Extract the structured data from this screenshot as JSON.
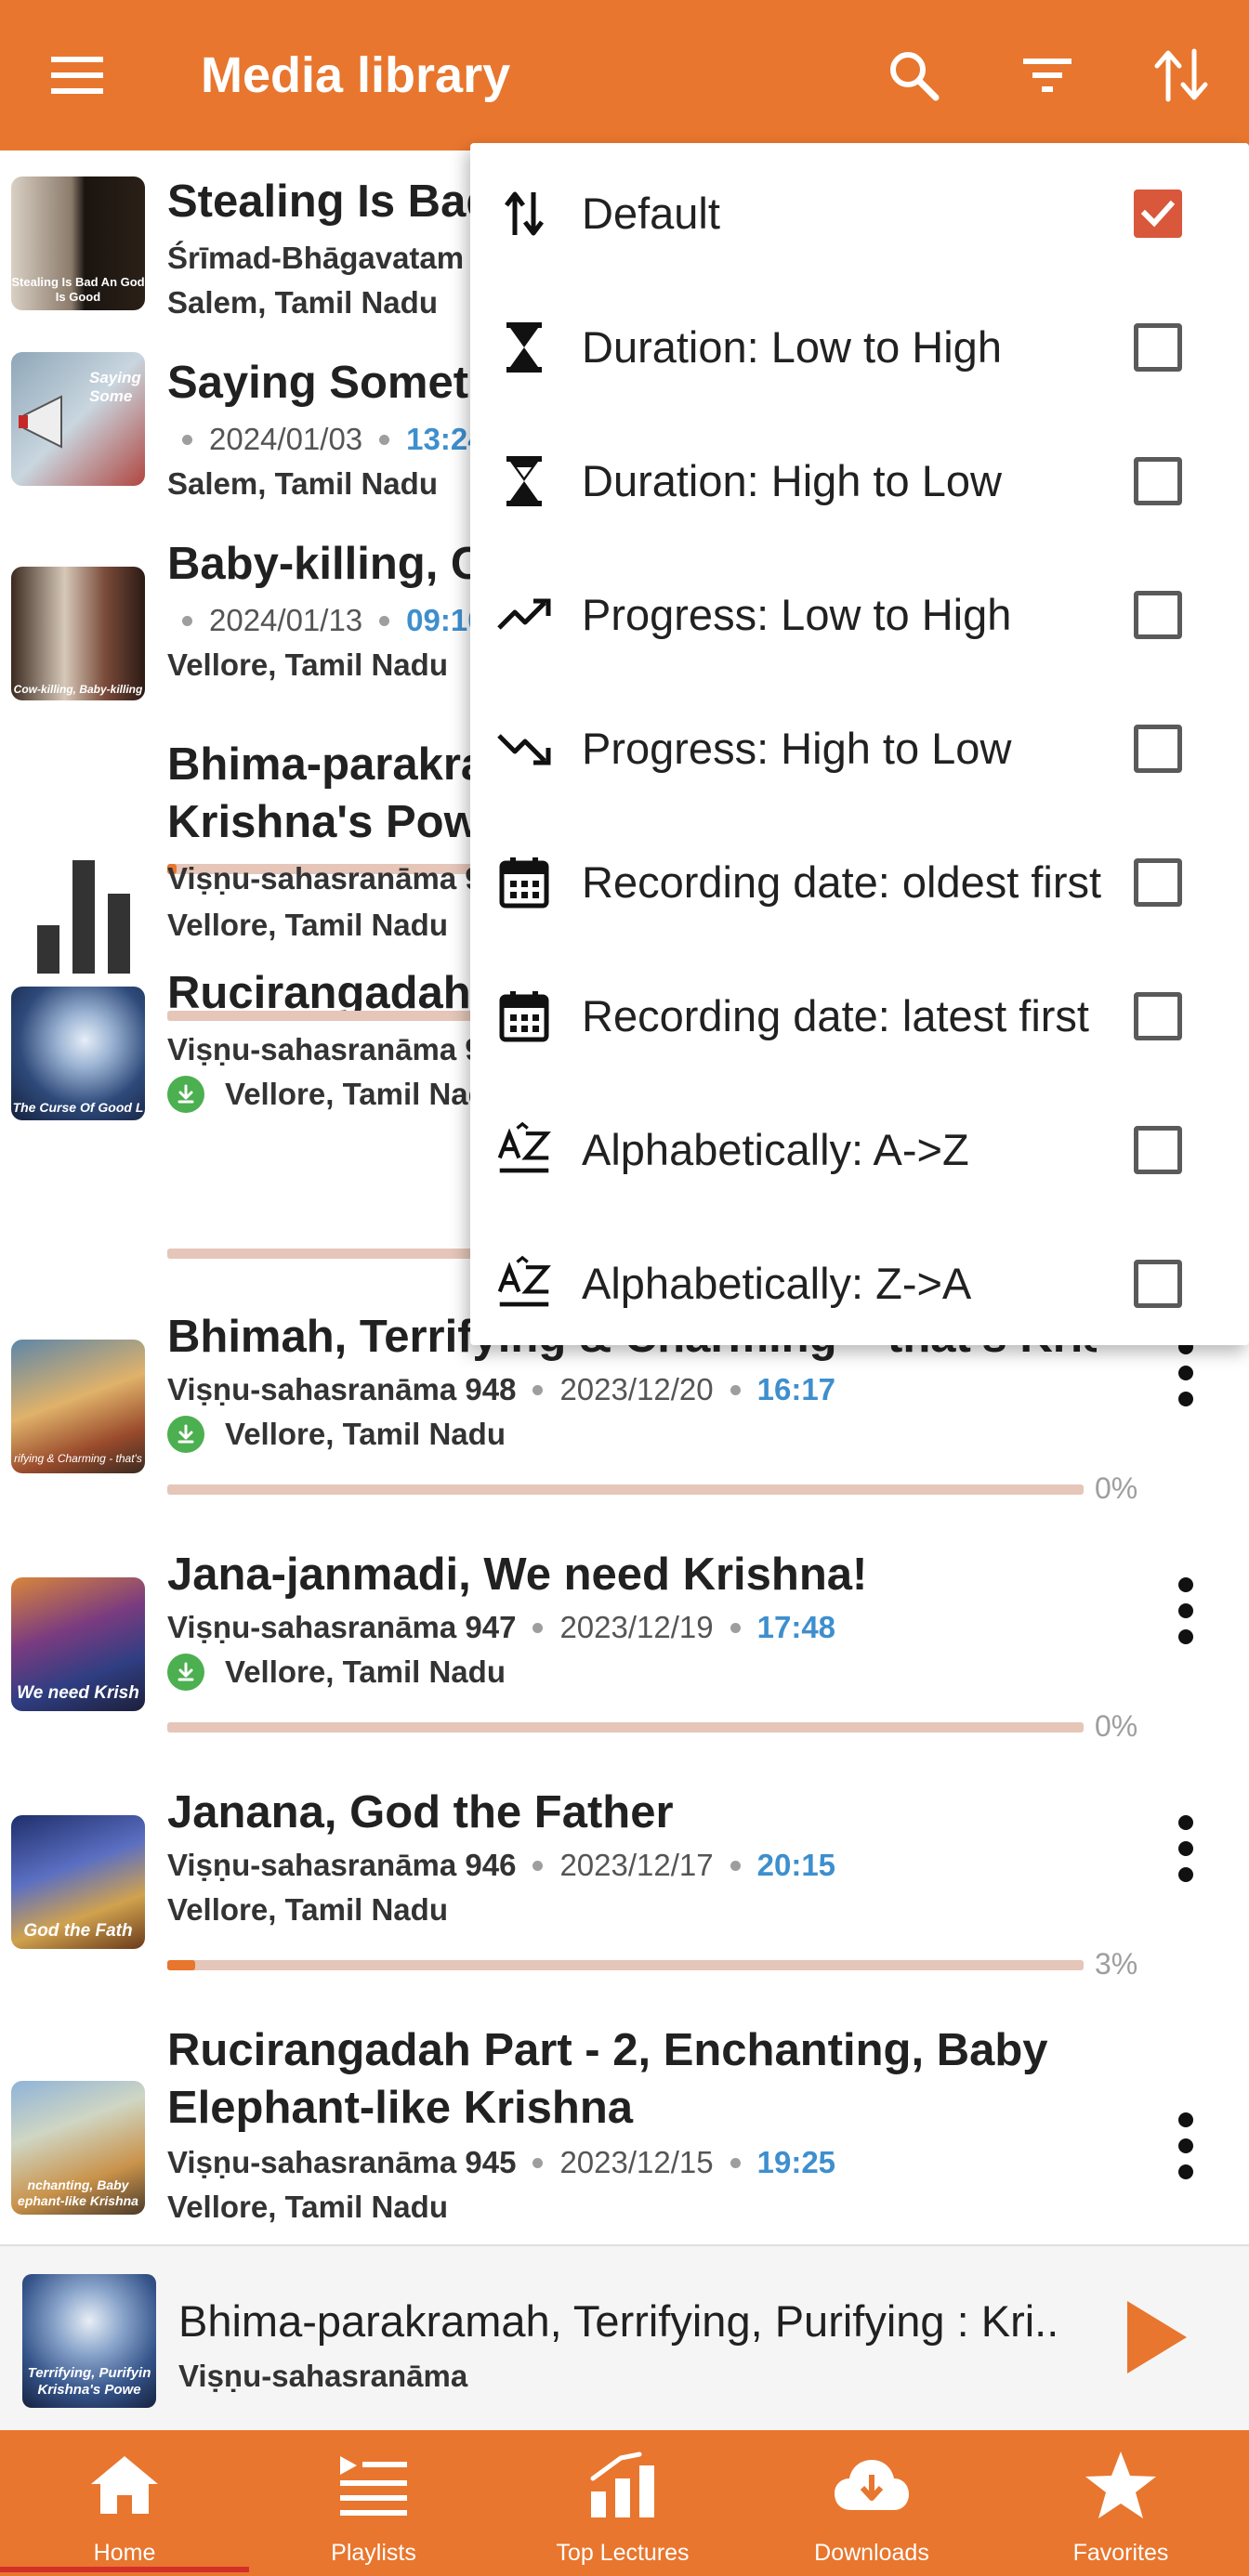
{
  "app_bar": {
    "title": "Media library",
    "icons": [
      "menu-icon",
      "search-icon",
      "filter-icon",
      "sort-icon"
    ]
  },
  "colors": {
    "brand": "#E8762E",
    "duration": "#3E8FCE",
    "progress_track": "#E5C6B9",
    "download_badge": "#4CAF50",
    "checkbox_checked": "#D9573A"
  },
  "sort_menu": {
    "options": [
      {
        "label": "Default",
        "icon": "default-sort-icon",
        "checked": true
      },
      {
        "label": "Duration: Low to High",
        "icon": "hourglass-icon",
        "checked": false
      },
      {
        "label": "Duration: High to Low",
        "icon": "hourglass-icon",
        "checked": false
      },
      {
        "label": "Progress: Low to High",
        "icon": "trending-up-icon",
        "checked": false
      },
      {
        "label": "Progress: High to Low",
        "icon": "trending-down-icon",
        "checked": false
      },
      {
        "label": "Recording date: oldest first",
        "icon": "calendar-icon",
        "checked": false
      },
      {
        "label": "Recording date: latest first",
        "icon": "calendar-icon",
        "checked": false
      },
      {
        "label": "Alphabetically: A->Z",
        "icon": "sort-alpha-icon",
        "checked": false
      },
      {
        "label": "Alphabetically: Z->A",
        "icon": "sort-alpha-icon",
        "checked": false
      }
    ]
  },
  "media_list": {
    "items": [
      {
        "title": "Stealing Is Bad",
        "series": "Śrīmad-Bhāgavatam 10",
        "location": "Salem, Tamil Nadu",
        "thumb_caption": "Stealing Is Bad An God Is Good"
      },
      {
        "title": "Saying Somethi",
        "date": "2024/01/03",
        "duration": "13:24",
        "location": "Salem, Tamil Nadu",
        "thumb_caption": "Saying Some"
      },
      {
        "title": "Baby-killing, Co",
        "date": "2024/01/13",
        "duration": "09:10",
        "location": "Vellore, Tamil Nadu",
        "thumb_caption": "Cow-killing, Baby-killing",
        "progress": 0.01
      },
      {
        "title": "Bhima-parakrar",
        "title_line2": "Krishna's Powe",
        "series": "Viṣṇu-sahasranāma 94",
        "location": "Vellore, Tamil Nadu",
        "now_playing": true,
        "progress": 0
      },
      {
        "title": "Rucirangadah P",
        "series": "Viṣṇu-sahasranāma 94",
        "location": "Vellore, Tamil Nadu",
        "downloaded": true,
        "thumb_caption": "The Curse Of Good L",
        "progress": 0
      },
      {
        "title": "Bhimah, Terrifying & Charming – that's Krishna!",
        "series": "Viṣṇu-sahasranāma 948",
        "date": "2023/12/20",
        "duration": "16:17",
        "location": "Vellore, Tamil Nadu",
        "downloaded": true,
        "progress": 0,
        "progress_label": "0%",
        "thumb_caption": "rifying & Charming - that's"
      },
      {
        "title": "Jana-janmadi, We need Krishna!",
        "series": "Viṣṇu-sahasranāma 947",
        "date": "2023/12/19",
        "duration": "17:48",
        "location": "Vellore, Tamil Nadu",
        "downloaded": true,
        "progress": 0,
        "progress_label": "0%",
        "thumb_caption": "We need Krish"
      },
      {
        "title": "Janana, God the Father",
        "series": "Viṣṇu-sahasranāma 946",
        "date": "2023/12/17",
        "duration": "20:15",
        "location": "Vellore, Tamil Nadu",
        "progress": 0.03,
        "progress_label": "3%",
        "thumb_caption": "God the Fath"
      },
      {
        "title": "Rucirangadah Part - 2, Enchanting, Baby",
        "title_line2": "Elephant-like Krishna",
        "series": "Viṣṇu-sahasranāma 945",
        "date": "2023/12/15",
        "duration": "19:25",
        "location": "Vellore, Tamil Nadu",
        "thumb_caption": "nchanting, Baby ephant-like Krishna"
      }
    ]
  },
  "mini_player": {
    "title": "Bhima-parakramah, Terrifying, Purifying : Kri..",
    "subtitle": "Viṣṇu-sahasranāma",
    "thumb_caption": "Terrifying, Purifyin Krishna's Powe"
  },
  "bottom_nav": {
    "items": [
      {
        "label": "Home",
        "icon": "home-icon",
        "active": true
      },
      {
        "label": "Playlists",
        "icon": "playlist-icon",
        "active": false
      },
      {
        "label": "Top Lectures",
        "icon": "bar-chart-icon",
        "active": false
      },
      {
        "label": "Downloads",
        "icon": "cloud-download-icon",
        "active": false
      },
      {
        "label": "Favorites",
        "icon": "star-icon",
        "active": false
      }
    ]
  }
}
